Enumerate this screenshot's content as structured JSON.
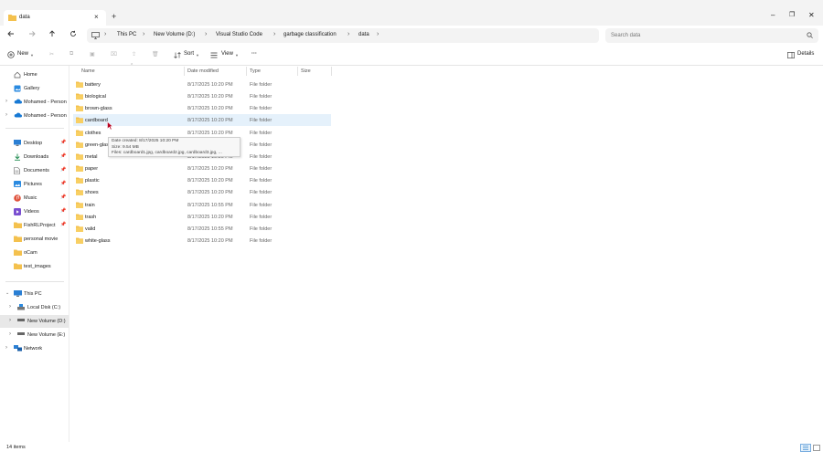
{
  "window": {
    "tab_title": "data",
    "tab_close": "×",
    "new_tab": "+",
    "minimize": "–",
    "restore": "❐",
    "close": "✕"
  },
  "address": {
    "breadcrumbs": [
      "This PC",
      "New Volume (D:)",
      "Visual Studio Code",
      "garbage classification",
      "data"
    ],
    "search_placeholder": "Search data"
  },
  "toolbar": {
    "new_label": "New",
    "sort_label": "Sort",
    "view_label": "View",
    "more_label": "···",
    "details_label": "Details"
  },
  "sidebar": {
    "quick": [
      {
        "label": "Home",
        "icon": "home-icon"
      },
      {
        "label": "Gallery",
        "icon": "gallery-icon"
      },
      {
        "label": "Mohamed - Person",
        "icon": "cloud-icon"
      },
      {
        "label": "Mohamed - Person",
        "icon": "cloud-icon"
      }
    ],
    "pinned": [
      {
        "label": "Desktop",
        "icon": "desktop-icon"
      },
      {
        "label": "Downloads",
        "icon": "downloads-icon"
      },
      {
        "label": "Documents",
        "icon": "documents-icon"
      },
      {
        "label": "Pictures",
        "icon": "pictures-icon"
      },
      {
        "label": "Music",
        "icon": "music-icon"
      },
      {
        "label": "Videos",
        "icon": "videos-icon"
      },
      {
        "label": "FishRLProject",
        "icon": "folder-icon"
      },
      {
        "label": "personal movie",
        "icon": "folder-icon"
      },
      {
        "label": "oCam",
        "icon": "folder-icon"
      },
      {
        "label": "test_images",
        "icon": "folder-icon"
      }
    ],
    "this_pc": "This PC",
    "drives": [
      {
        "label": "Local Disk (C:)"
      },
      {
        "label": "New Volume (D:)"
      },
      {
        "label": "New Volume (E:)"
      }
    ],
    "network": "Network"
  },
  "columns": {
    "name": "Name",
    "date": "Date modified",
    "type": "Type",
    "size": "Size"
  },
  "files": [
    {
      "name": "battery",
      "date": "8/17/2025 10:20 PM",
      "type": "File folder"
    },
    {
      "name": "biological",
      "date": "8/17/2025 10:20 PM",
      "type": "File folder"
    },
    {
      "name": "brown-glass",
      "date": "8/17/2025 10:20 PM",
      "type": "File folder"
    },
    {
      "name": "cardboard",
      "date": "8/17/2025 10:20 PM",
      "type": "File folder"
    },
    {
      "name": "clothes",
      "date": "8/17/2025 10:20 PM",
      "type": "File folder"
    },
    {
      "name": "green-glass",
      "date": "8/17/2025 10:20 PM",
      "type": "File folder"
    },
    {
      "name": "metal",
      "date": "8/17/2025 10:20 PM",
      "type": "File folder"
    },
    {
      "name": "paper",
      "date": "8/17/2025 10:20 PM",
      "type": "File folder"
    },
    {
      "name": "plastic",
      "date": "8/17/2025 10:20 PM",
      "type": "File folder"
    },
    {
      "name": "shoes",
      "date": "8/17/2025 10:20 PM",
      "type": "File folder"
    },
    {
      "name": "train",
      "date": "8/17/2025 10:55 PM",
      "type": "File folder"
    },
    {
      "name": "trash",
      "date": "8/17/2025 10:20 PM",
      "type": "File folder"
    },
    {
      "name": "valid",
      "date": "8/17/2025 10:55 PM",
      "type": "File folder"
    },
    {
      "name": "white-glass",
      "date": "8/17/2025 10:20 PM",
      "type": "File folder"
    }
  ],
  "tooltip": {
    "created": "Date created: 8/17/2025 10:20 PM",
    "size": "Size: 9.54 MB",
    "files": "Files: cardboard1.jpg, cardboard2.jpg, cardboard3.jpg, ..."
  },
  "status": {
    "item_count": "14 items"
  },
  "colors": {
    "folder": "#f4c14e",
    "accent": "#0067c0",
    "hover_row": "#e5f1fb",
    "selected_nav": "#e8e8e8"
  }
}
